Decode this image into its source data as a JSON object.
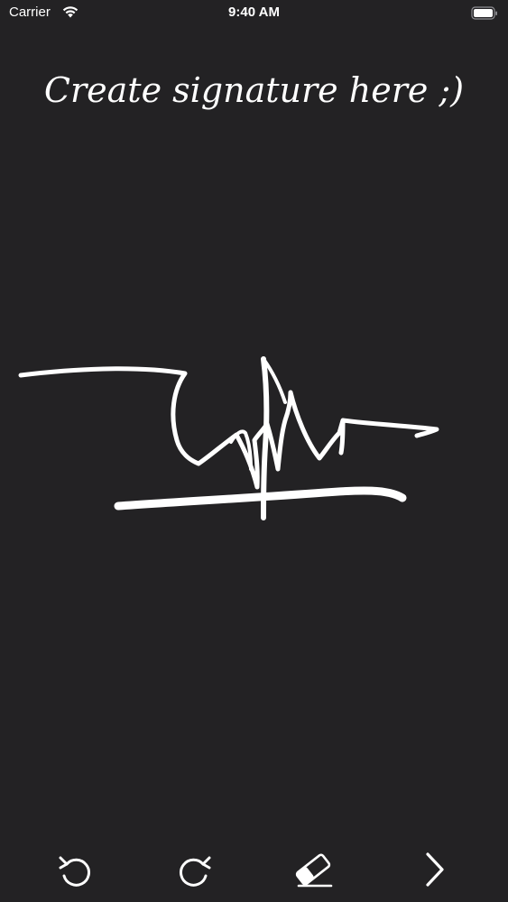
{
  "status_bar": {
    "carrier": "Carrier",
    "time": "9:40 AM",
    "icons": [
      "wifi-icon",
      "battery-icon"
    ]
  },
  "title": "Create signature here ;)",
  "canvas": {
    "background": "#232224",
    "stroke_color": "#ffffff"
  },
  "toolbar": {
    "items": [
      {
        "name": "undo-button",
        "icon": "undo-icon"
      },
      {
        "name": "redo-button",
        "icon": "redo-icon"
      },
      {
        "name": "eraser-button",
        "icon": "eraser-icon"
      },
      {
        "name": "next-button",
        "icon": "chevron-right-icon"
      }
    ]
  }
}
